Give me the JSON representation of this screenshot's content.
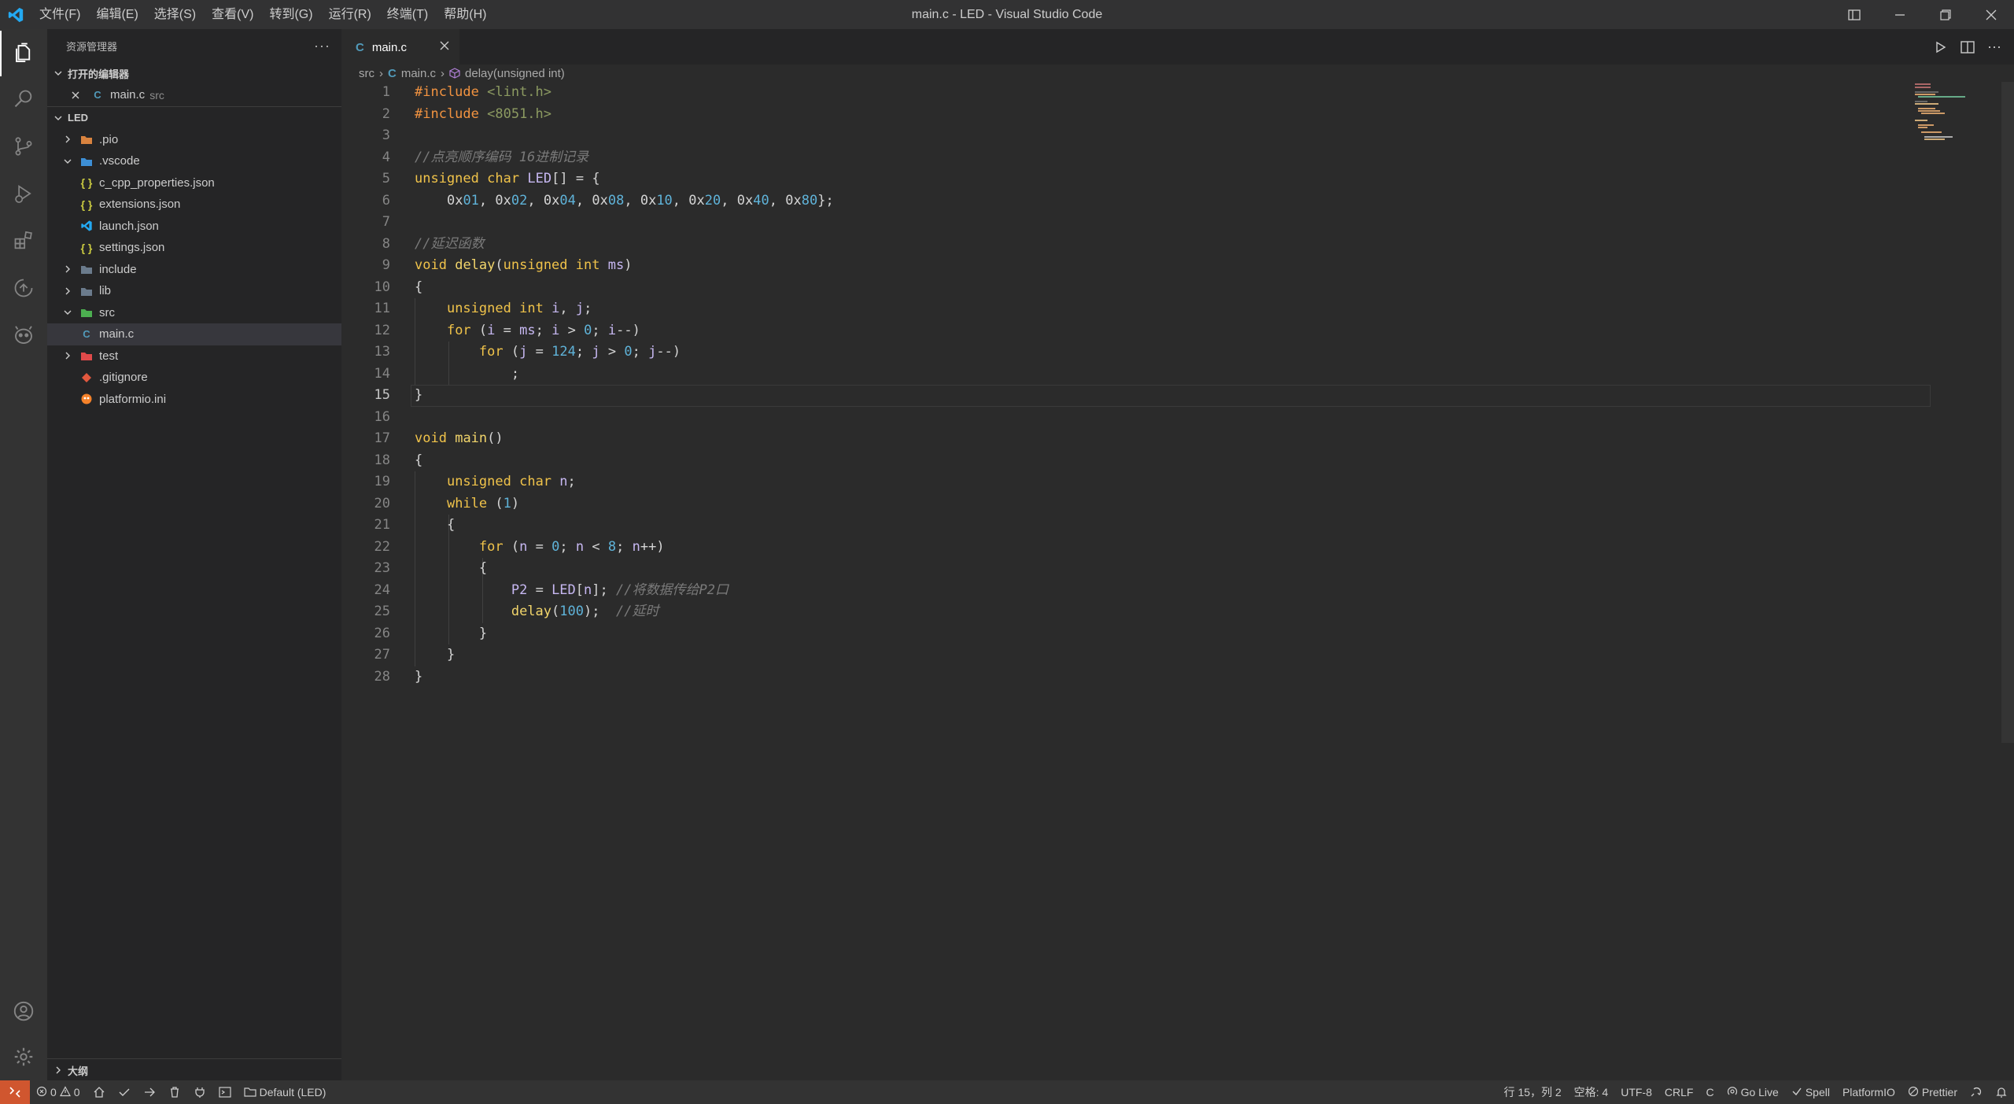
{
  "window": {
    "title": "main.c - LED - Visual Studio Code",
    "menu": [
      "文件(F)",
      "编辑(E)",
      "选择(S)",
      "查看(V)",
      "转到(G)",
      "运行(R)",
      "终端(T)",
      "帮助(H)"
    ]
  },
  "activity_bar": {
    "items": [
      "files-icon",
      "search-icon",
      "source-control-icon",
      "run-debug-icon",
      "extensions-icon",
      "remote-icon",
      "platformio-icon"
    ],
    "bottom": [
      "account-icon",
      "settings-gear-icon"
    ]
  },
  "sidebar": {
    "title": "资源管理器",
    "open_editors_header": "打开的编辑器",
    "open_editor": {
      "name": "main.c",
      "folder": "src"
    },
    "project_header": "LED",
    "tree": [
      {
        "label": ".pio",
        "depth": 0,
        "kind": "folder",
        "expanded": false
      },
      {
        "label": ".vscode",
        "depth": 0,
        "kind": "folder",
        "expanded": true
      },
      {
        "label": "c_cpp_properties.json",
        "depth": 1,
        "kind": "json"
      },
      {
        "label": "extensions.json",
        "depth": 1,
        "kind": "json"
      },
      {
        "label": "launch.json",
        "depth": 1,
        "kind": "vscode"
      },
      {
        "label": "settings.json",
        "depth": 1,
        "kind": "json"
      },
      {
        "label": "include",
        "depth": 0,
        "kind": "folder",
        "expanded": false
      },
      {
        "label": "lib",
        "depth": 0,
        "kind": "folder",
        "expanded": false
      },
      {
        "label": "src",
        "depth": 0,
        "kind": "folder",
        "expanded": true
      },
      {
        "label": "main.c",
        "depth": 1,
        "kind": "c",
        "selected": true
      },
      {
        "label": "test",
        "depth": 0,
        "kind": "folder",
        "expanded": false
      },
      {
        "label": ".gitignore",
        "depth": 0,
        "kind": "git"
      },
      {
        "label": "platformio.ini",
        "depth": 0,
        "kind": "pio"
      }
    ],
    "outline_header": "大纲"
  },
  "editor": {
    "tab": "main.c",
    "breadcrumb": {
      "folder": "src",
      "file": "main.c",
      "symbol": "delay(unsigned int)"
    },
    "current_line": 15,
    "lines": [
      "#include <lint.h>",
      "#include <8051.h>",
      "",
      "//点亮顺序编码 16进制记录",
      "unsigned char LED[] = {",
      "    0x01, 0x02, 0x04, 0x08, 0x10, 0x20, 0x40, 0x80};",
      "",
      "//延迟函数",
      "void delay(unsigned int ms)",
      "{",
      "    unsigned int i, j;",
      "    for (i = ms; i > 0; i--)",
      "        for (j = 124; j > 0; j--)",
      "            ;",
      "}",
      "",
      "void main()",
      "{",
      "    unsigned char n;",
      "    while (1)",
      "    {",
      "        for (n = 0; n < 8; n++)",
      "        {",
      "            P2 = LED[n]; //将数据传给P2口",
      "            delay(100);  //延时",
      "        }",
      "    }",
      "}"
    ]
  },
  "statusbar": {
    "errors": "0",
    "warnings": "0",
    "env": "Default (LED)",
    "position": "行 15，列 2",
    "spaces": "空格: 4",
    "encoding": "UTF-8",
    "eol": "CRLF",
    "language": "C",
    "golive": "Go Live",
    "spell": "Spell",
    "platformio": "PlatformIO",
    "prettier": "Prettier",
    "colors": {
      "remote": "#d0562f",
      "background": "#333333"
    }
  }
}
